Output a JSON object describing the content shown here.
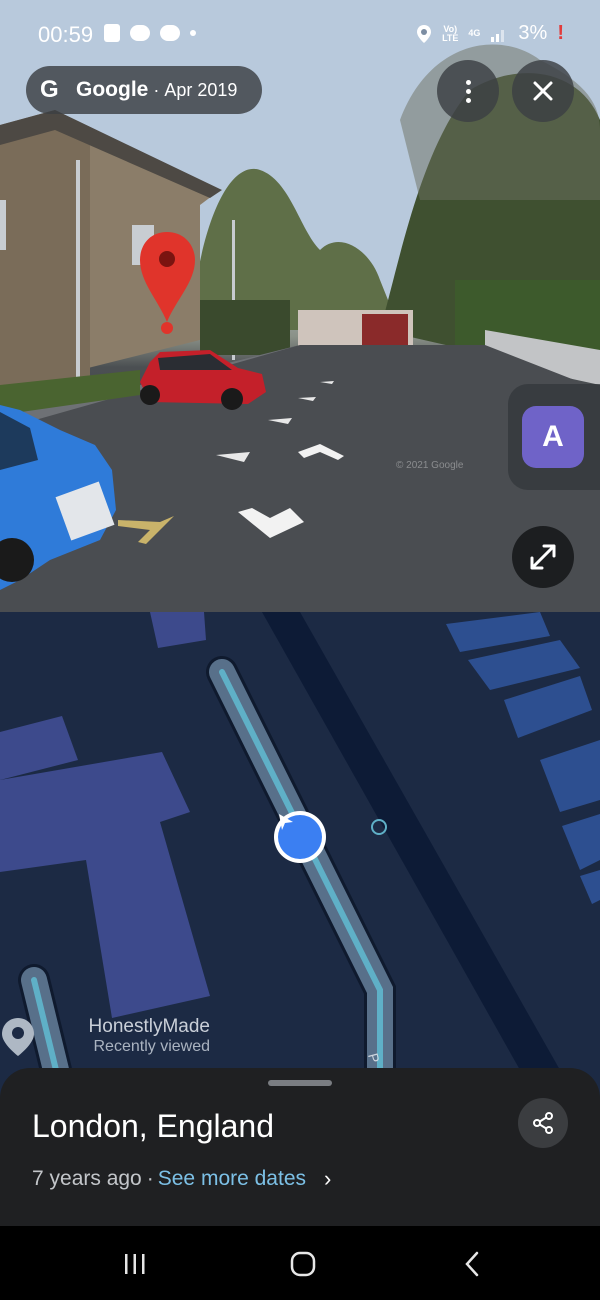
{
  "status_bar": {
    "time": "00:59",
    "network_top": "Vo)",
    "network_bottom": "LTE",
    "net_type": "4G",
    "battery": "3%",
    "battery_warn": "!"
  },
  "streetview": {
    "provider_logo": "G",
    "provider": "Google",
    "separator": "·",
    "capture_date": "Apr 2019",
    "watermark": "© 2021 Google",
    "translate_letter": "A",
    "more_icon": "more-vertical-icon",
    "close_icon": "close-icon",
    "expand_icon": "expand-icon"
  },
  "map": {
    "place_name": "HonestlyMade",
    "place_subtitle": "Recently viewed",
    "road_letter": "P"
  },
  "sheet": {
    "title": "London, England",
    "age": "7 years ago",
    "separator": "·",
    "link": "See more dates",
    "chevron": "›"
  },
  "colors": {
    "map_bg": "#1c2a44",
    "building": "#3d4a8c",
    "road_fill": "#58708a",
    "road_center": "#5fb0c7",
    "location_blue": "#3b7ff2",
    "link": "#7cc0e6",
    "pin_red": "#e0342b"
  }
}
